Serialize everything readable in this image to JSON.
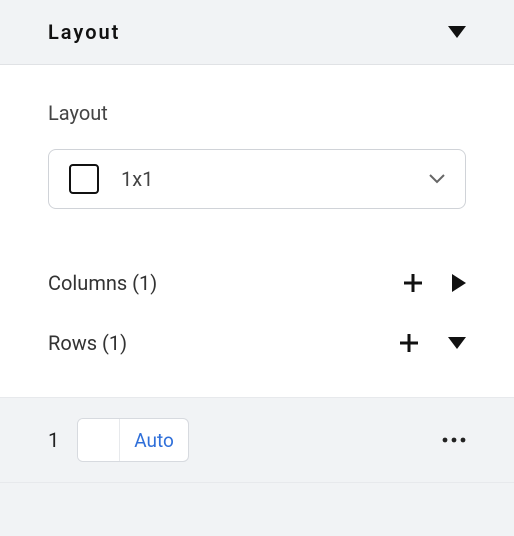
{
  "header": {
    "title": "Layout"
  },
  "panel": {
    "subheader": "Layout",
    "select": {
      "label": "1x1"
    },
    "columns": {
      "label": "Columns (1)"
    },
    "rows": {
      "label": "Rows (1)"
    }
  },
  "edit": {
    "index": "1",
    "value": "Auto"
  }
}
